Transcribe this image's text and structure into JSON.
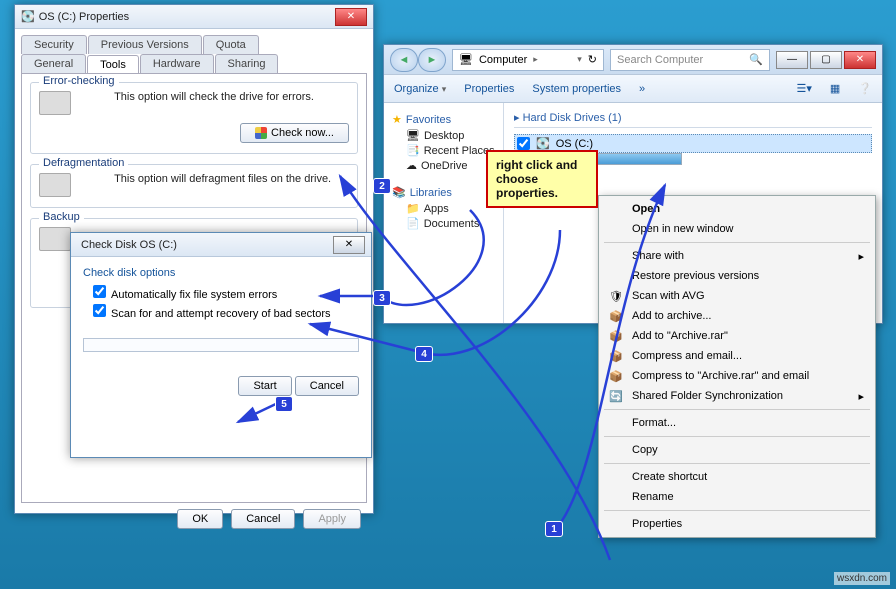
{
  "properties": {
    "title": "OS (C:) Properties",
    "tabs_row1": [
      "Security",
      "Previous Versions",
      "Quota"
    ],
    "tabs_row2": [
      "General",
      "Tools",
      "Hardware",
      "Sharing"
    ],
    "active_tab": "Tools",
    "error_check": {
      "title": "Error-checking",
      "desc": "This option will check the drive for errors.",
      "button": "Check now..."
    },
    "defrag": {
      "title": "Defragmentation",
      "desc": "This option will defragment files on the drive."
    },
    "backup": {
      "title": "Backup"
    },
    "buttons": {
      "ok": "OK",
      "cancel": "Cancel",
      "apply": "Apply"
    }
  },
  "chkdsk": {
    "title": "Check Disk OS (C:)",
    "options_title": "Check disk options",
    "opt1": "Automatically fix file system errors",
    "opt2": "Scan for and attempt recovery of bad sectors",
    "start": "Start",
    "cancel": "Cancel"
  },
  "explorer": {
    "breadcrumb": "Computer",
    "search_placeholder": "Search Computer",
    "toolbar": {
      "organize": "Organize",
      "properties": "Properties",
      "sysprops": "System properties",
      "more": "»"
    },
    "nav": {
      "favorites": "Favorites",
      "desktop": "Desktop",
      "recent": "Recent Places",
      "onedrive": "OneDrive",
      "libraries": "Libraries",
      "apps": "Apps",
      "documents": "Documents"
    },
    "section_head": "Hard Disk Drives (1)",
    "drive_label": "OS (C:)"
  },
  "context_menu": [
    {
      "label": "Open",
      "bold": true
    },
    {
      "label": "Open in new window"
    },
    {
      "sep": true
    },
    {
      "label": "Share with",
      "sub": true
    },
    {
      "label": "Restore previous versions"
    },
    {
      "label": "Scan with AVG",
      "icon": "avg"
    },
    {
      "label": "Add to archive...",
      "icon": "rar"
    },
    {
      "label": "Add to \"Archive.rar\"",
      "icon": "rar"
    },
    {
      "label": "Compress and email...",
      "icon": "rar"
    },
    {
      "label": "Compress to \"Archive.rar\" and email",
      "icon": "rar"
    },
    {
      "label": "Shared Folder Synchronization",
      "icon": "sync",
      "sub": true
    },
    {
      "sep": true
    },
    {
      "label": "Format..."
    },
    {
      "sep": true
    },
    {
      "label": "Copy"
    },
    {
      "sep": true
    },
    {
      "label": "Create shortcut"
    },
    {
      "label": "Rename"
    },
    {
      "sep": true
    },
    {
      "label": "Properties"
    }
  ],
  "annotation": {
    "callout": "right click and choose properties.",
    "steps": [
      "1",
      "2",
      "3",
      "4",
      "5"
    ]
  },
  "footer": "wsxdn.com"
}
